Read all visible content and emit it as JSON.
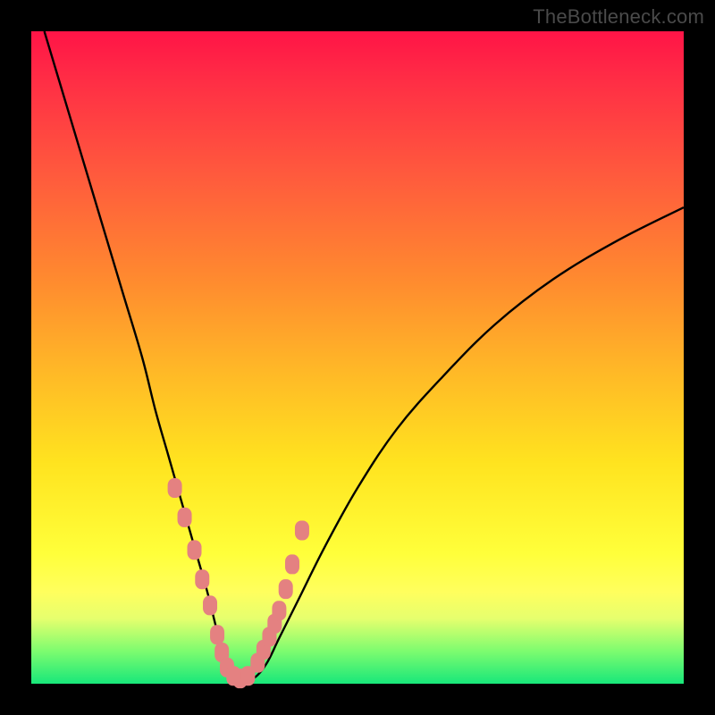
{
  "watermark": "TheBottleneck.com",
  "colors": {
    "curve": "#000000",
    "markers": "#e48181",
    "background_top": "#ff1447",
    "background_bottom": "#18e77a"
  },
  "chart_data": {
    "type": "line",
    "title": "",
    "xlabel": "",
    "ylabel": "",
    "xlim": [
      0,
      100
    ],
    "ylim": [
      0,
      100
    ],
    "series": [
      {
        "name": "bottleneck-curve",
        "x": [
          2,
          5,
          8,
          11,
          14,
          17,
          19,
          21,
          23,
          25,
          27,
          28.5,
          30,
          32,
          34,
          36,
          38,
          41,
          45,
          50,
          56,
          63,
          71,
          80,
          90,
          100
        ],
        "y": [
          100,
          90,
          80,
          70,
          60,
          50,
          42,
          35,
          28,
          21,
          14,
          8,
          3,
          0.8,
          0.8,
          3,
          7,
          13,
          21,
          30,
          39,
          47,
          55,
          62,
          68,
          73
        ]
      }
    ],
    "markers": {
      "name": "highlight-points",
      "x": [
        22,
        23.5,
        25,
        26.2,
        27.4,
        28.5,
        29.2,
        30,
        31,
        32,
        33.2,
        34.7,
        35.6,
        36.5,
        37.3,
        38,
        39,
        40,
        41.5
      ],
      "y": [
        30,
        25.5,
        20.5,
        16,
        12,
        7.5,
        4.8,
        2.5,
        1.2,
        0.8,
        1.2,
        3.2,
        5.2,
        7.2,
        9.2,
        11.2,
        14.5,
        18.3,
        23.5
      ]
    }
  }
}
